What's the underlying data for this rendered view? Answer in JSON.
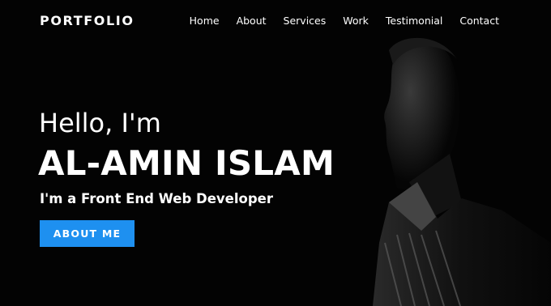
{
  "nav": {
    "logo": "PORTFOLIO",
    "items": [
      {
        "label": "Home"
      },
      {
        "label": "About"
      },
      {
        "label": "Services"
      },
      {
        "label": "Work"
      },
      {
        "label": "Testimonial"
      },
      {
        "label": "Contact"
      }
    ]
  },
  "hero": {
    "greeting": "Hello, I'm",
    "name": "AL-AMIN ISLAM",
    "subtitle": "I'm a Front End Web Developer",
    "button_label": "ABOUT ME"
  },
  "colors": {
    "background": "#030303",
    "accent": "#1e90f0",
    "text": "#ffffff"
  }
}
